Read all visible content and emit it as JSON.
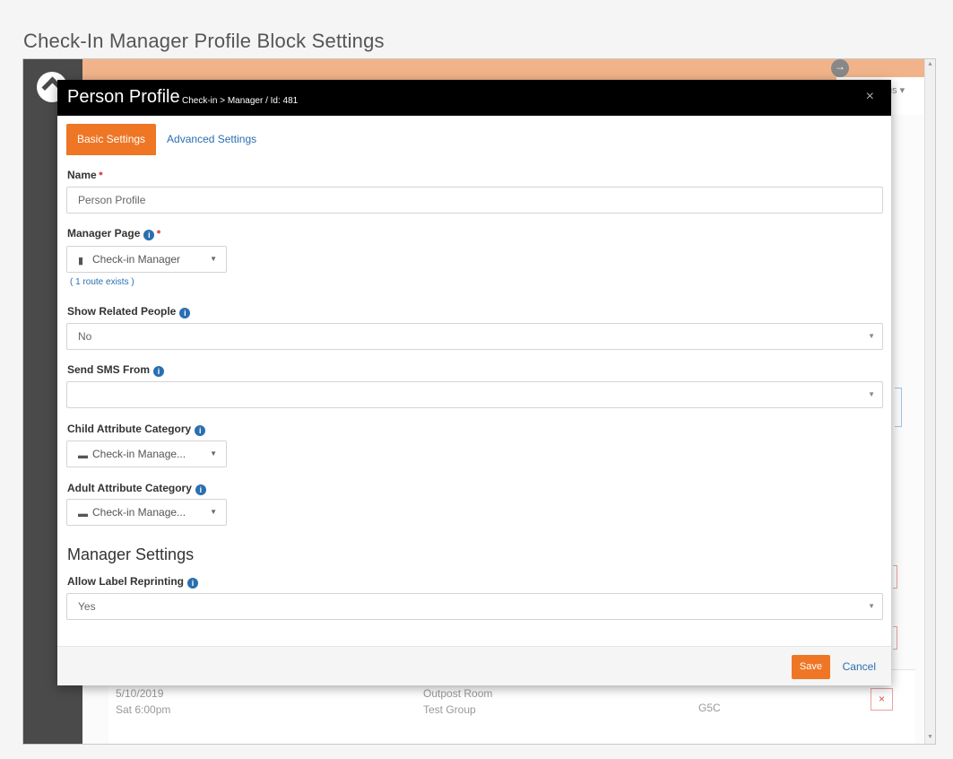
{
  "doc_title": "Check-In Manager Profile Block Settings",
  "background": {
    "user_menu": "us ▾",
    "rows": [
      {
        "date": "5/10/2019",
        "time": "Sat 6:00pm",
        "room": "Outpost Room",
        "group": "Test Group",
        "code": "G5C"
      }
    ],
    "remove_glyph": "×"
  },
  "modal": {
    "title": "Person Profile",
    "crumb": "Check-in > Manager / Id: 481",
    "close_glyph": "×",
    "tabs": [
      {
        "label": "Basic Settings",
        "active": true
      },
      {
        "label": "Advanced Settings",
        "active": false
      }
    ],
    "fields": {
      "name": {
        "label": "Name",
        "value": "Person Profile",
        "required": true
      },
      "manager_page": {
        "label": "Manager Page",
        "value": "Check-in Manager",
        "route": "( 1 route exists )",
        "required": true
      },
      "show_related": {
        "label": "Show Related People",
        "value": "No"
      },
      "send_sms": {
        "label": "Send SMS From",
        "value": ""
      },
      "child_attr": {
        "label": "Child Attribute Category",
        "value": "Check-in Manage..."
      },
      "adult_attr": {
        "label": "Adult Attribute Category",
        "value": "Check-in Manage..."
      },
      "allow_reprint": {
        "label": "Allow Label Reprinting",
        "value": "Yes"
      }
    },
    "section_heading": "Manager Settings",
    "footer": {
      "save": "Save",
      "cancel": "Cancel"
    }
  },
  "colors": {
    "accent": "#ee7625",
    "link": "#2a6fb0",
    "header": "#000000",
    "required": "#d9534f"
  },
  "icons": [
    "info-icon",
    "page-icon",
    "folder-icon",
    "close-icon",
    "caret-down-icon",
    "forward-circle-icon"
  ]
}
